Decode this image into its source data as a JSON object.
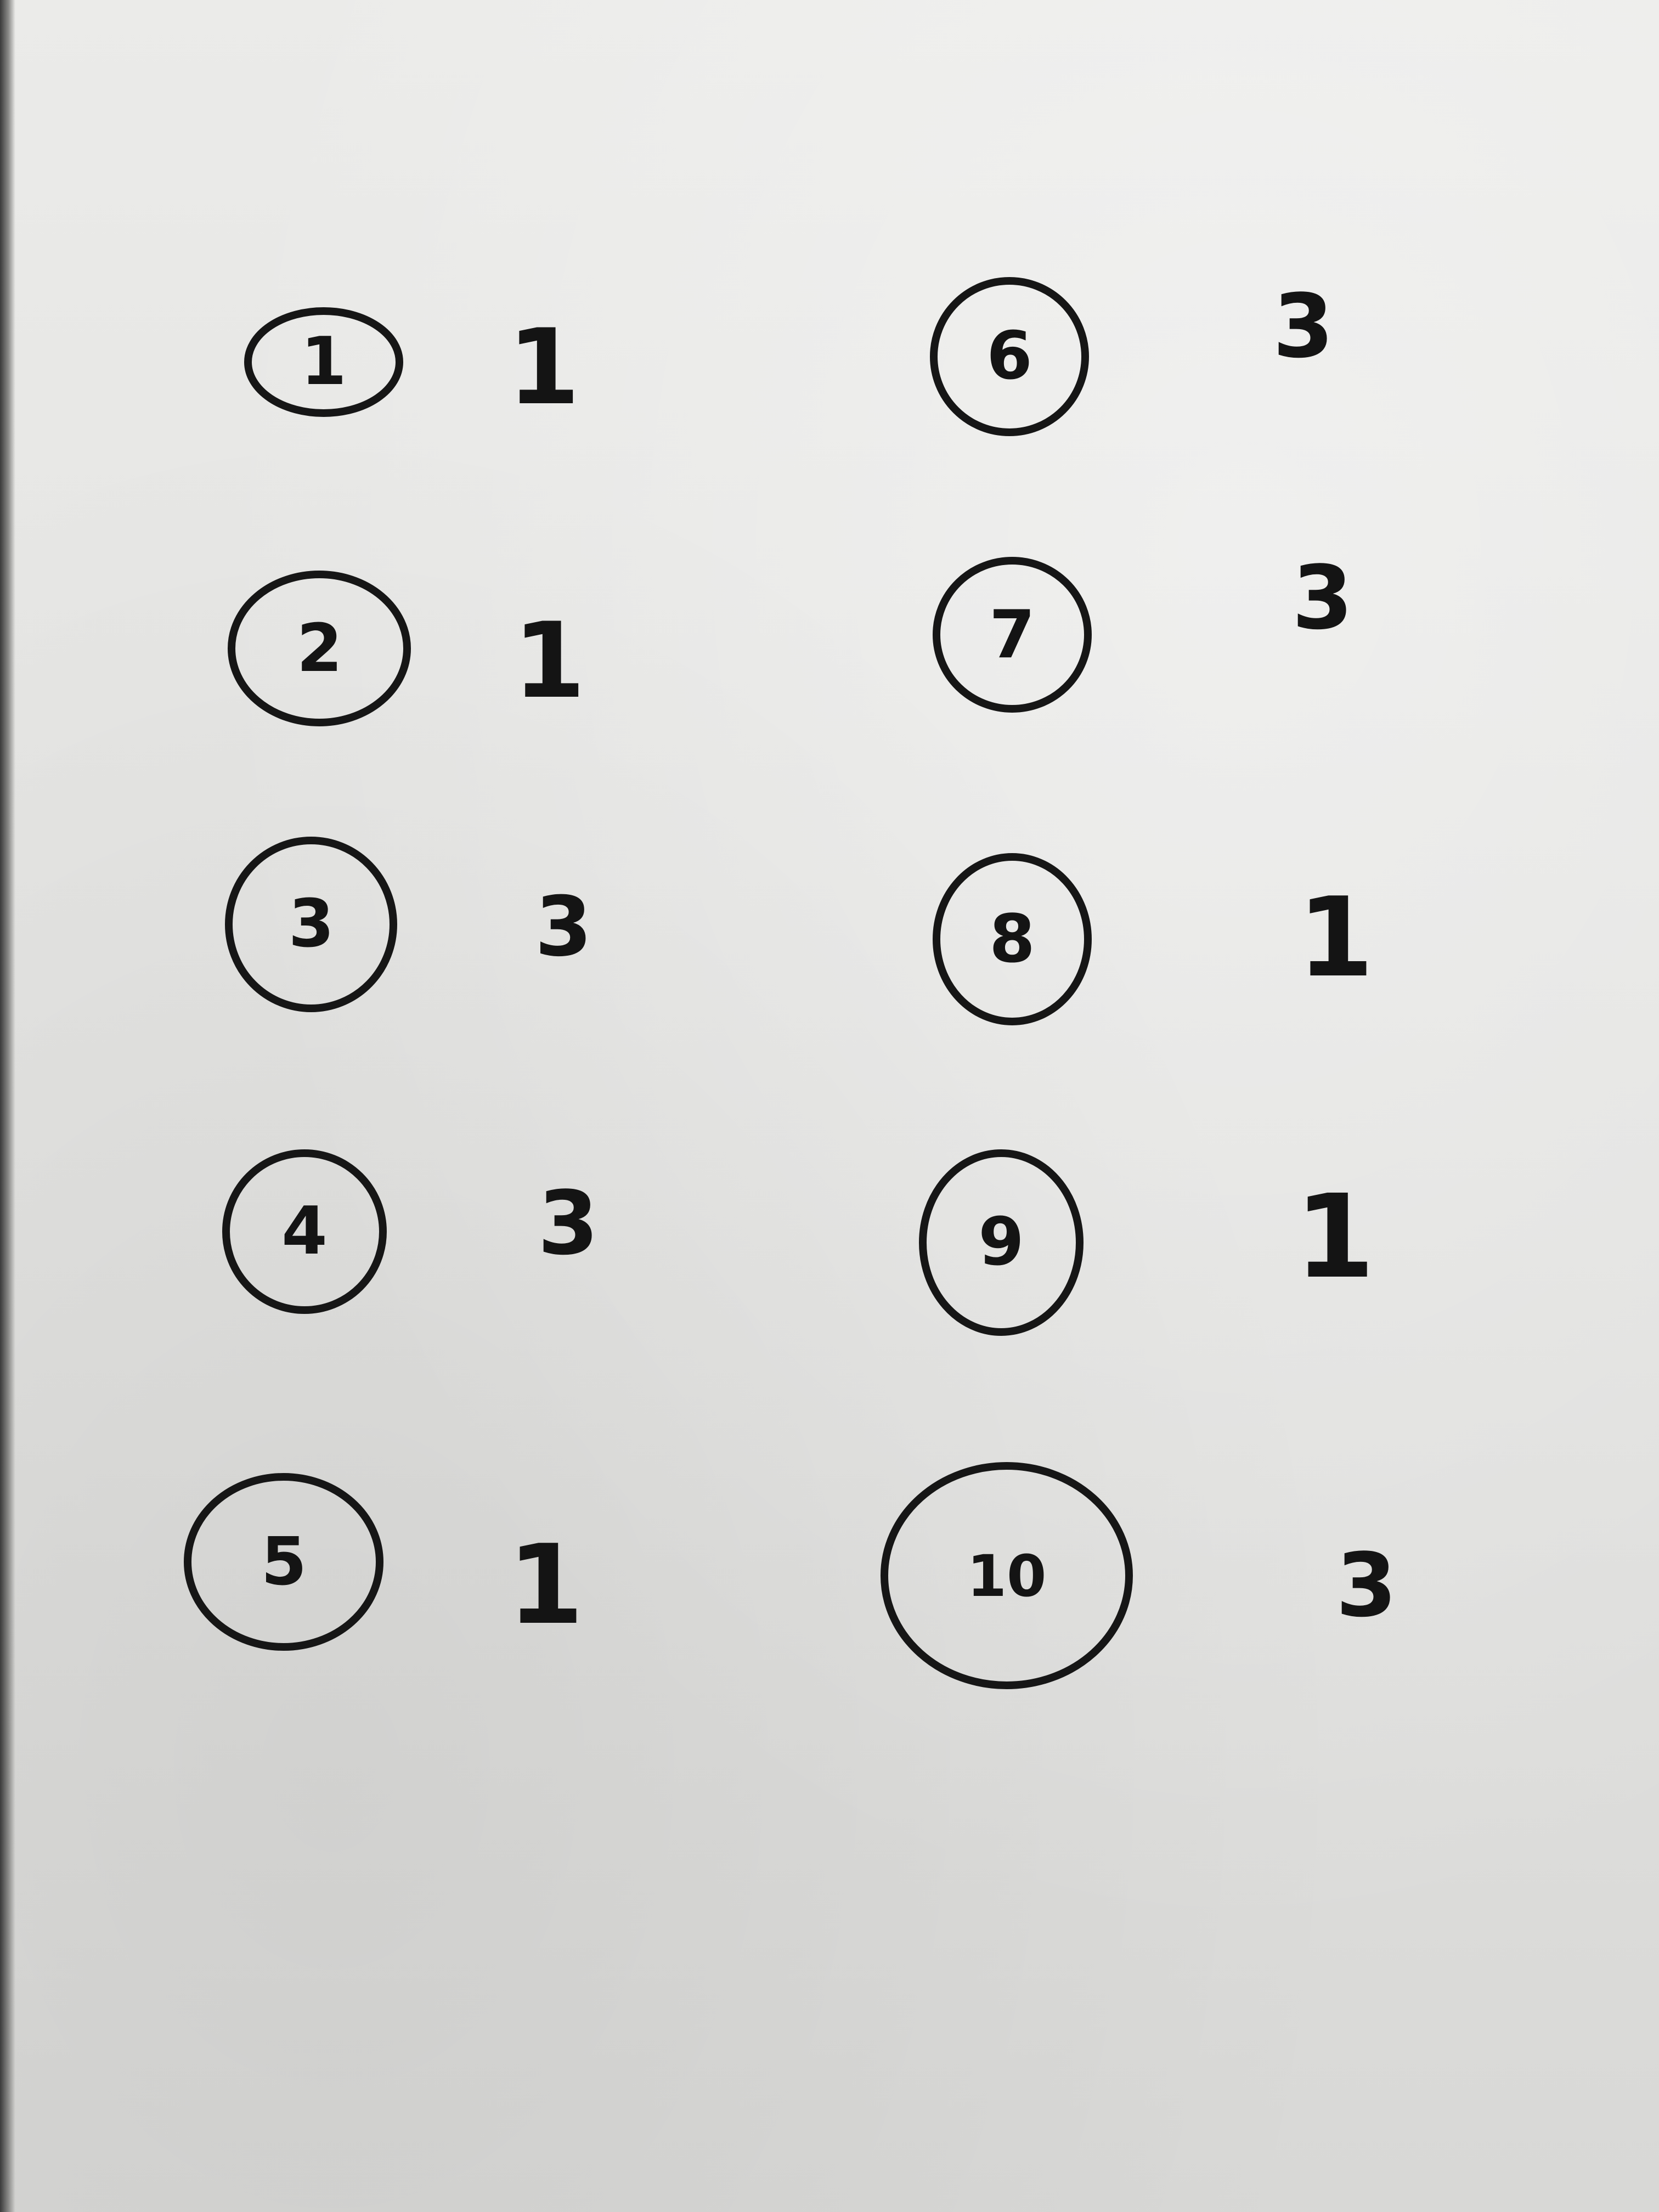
{
  "sheet": {
    "entries": [
      {
        "number": "1",
        "answer": "1"
      },
      {
        "number": "2",
        "answer": "1"
      },
      {
        "number": "3",
        "answer": "3"
      },
      {
        "number": "4",
        "answer": "3"
      },
      {
        "number": "5",
        "answer": "1"
      },
      {
        "number": "6",
        "answer": "3"
      },
      {
        "number": "7",
        "answer": "3"
      },
      {
        "number": "8",
        "answer": "1"
      },
      {
        "number": "9",
        "answer": "1"
      },
      {
        "number": "10",
        "answer": "3"
      }
    ]
  }
}
